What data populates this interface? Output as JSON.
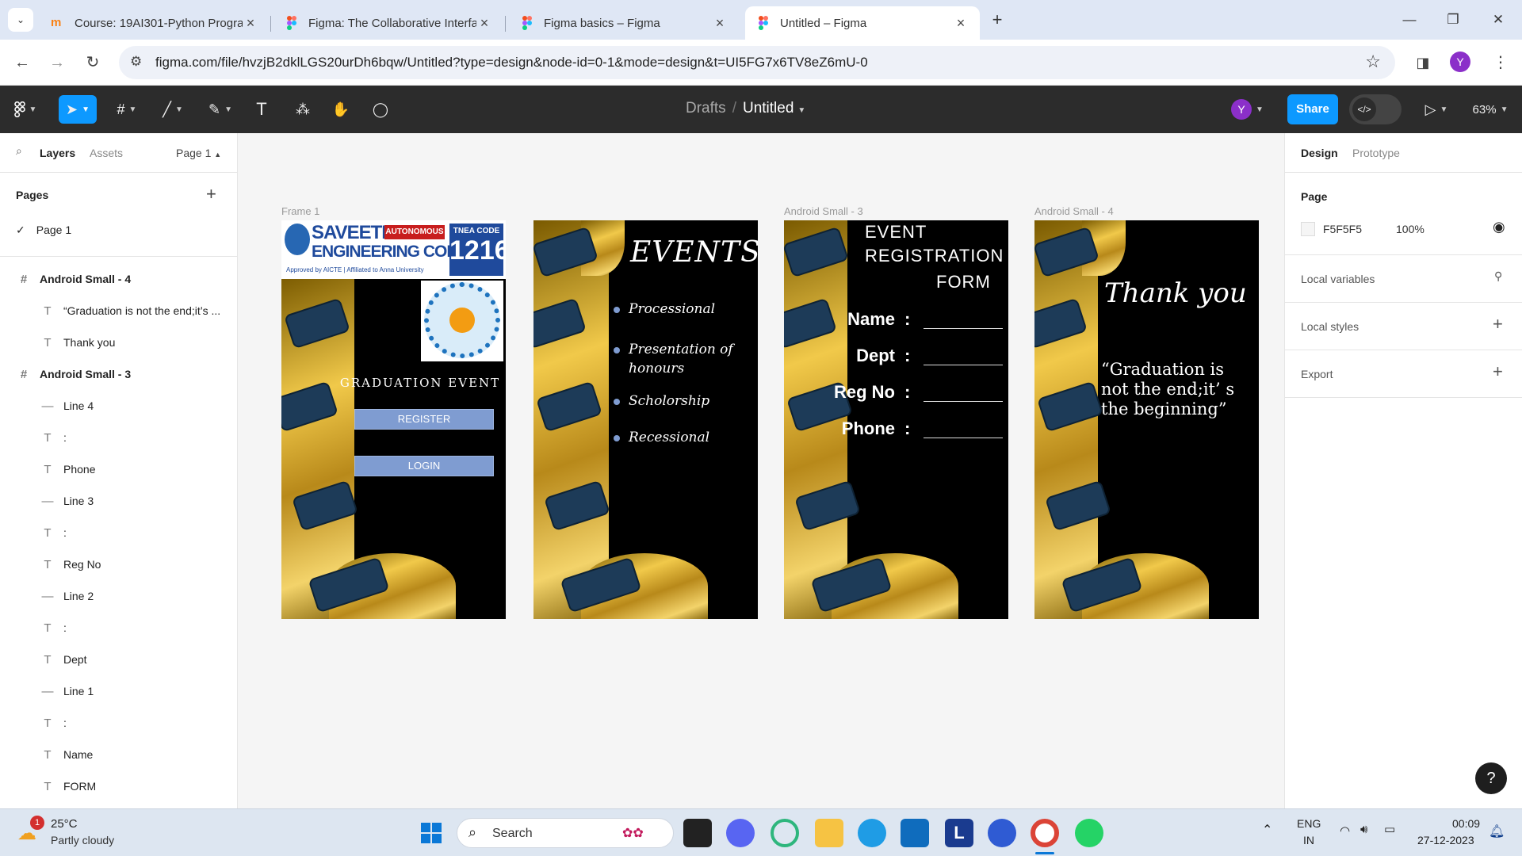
{
  "browser": {
    "tabs": [
      {
        "title": "Course: 19AI301-Python Progra",
        "favicon": "moodle-icon",
        "active": false
      },
      {
        "title": "Figma: The Collaborative Interfa",
        "favicon": "figma-icon",
        "active": false
      },
      {
        "title": "Figma basics – Figma",
        "favicon": "figma-icon",
        "active": false
      },
      {
        "title": "Untitled – Figma",
        "favicon": "figma-icon",
        "active": true
      }
    ],
    "new_tab": "+",
    "url": "figma.com/file/hvzjB2dklLGS20urDh6bqw/Untitled?type=design&node-id=0-1&mode=design&t=UI5FG7x6TV8eZ6mU-0",
    "profile_initial": "Y"
  },
  "figma": {
    "breadcrumb_parent": "Drafts",
    "breadcrumb_sep": "/",
    "file_name": "Untitled",
    "user_initial": "Y",
    "share_label": "Share",
    "zoom": "63%",
    "left_tabs": {
      "layers": "Layers",
      "assets": "Assets",
      "page_selector": "Page 1"
    },
    "pages_title": "Pages",
    "pages": [
      "Page 1"
    ],
    "layers": [
      {
        "name": "Android Small - 4",
        "type": "frame"
      },
      {
        "name": "“Graduation is not the end;it’s ...",
        "type": "text"
      },
      {
        "name": "Thank you",
        "type": "text"
      },
      {
        "name": "Android Small - 3",
        "type": "frame"
      },
      {
        "name": "Line 4",
        "type": "line"
      },
      {
        "name": ":",
        "type": "text"
      },
      {
        "name": "Phone",
        "type": "text"
      },
      {
        "name": "Line 3",
        "type": "line"
      },
      {
        "name": ":",
        "type": "text"
      },
      {
        "name": "Reg No",
        "type": "text"
      },
      {
        "name": "Line 2",
        "type": "line"
      },
      {
        "name": ":",
        "type": "text"
      },
      {
        "name": "Dept",
        "type": "text"
      },
      {
        "name": "Line 1",
        "type": "line"
      },
      {
        "name": ":",
        "type": "text"
      },
      {
        "name": "Name",
        "type": "text"
      },
      {
        "name": "FORM",
        "type": "text"
      }
    ],
    "right_tabs": {
      "design": "Design",
      "prototype": "Prototype"
    },
    "page_section": {
      "title": "Page",
      "color": "F5F5F5",
      "opacity": "100%"
    },
    "sections": [
      "Local variables",
      "Local styles",
      "Export"
    ],
    "help": "?"
  },
  "frames": {
    "frame1": {
      "label": "Frame 1",
      "college_name_1": "SAVEETHA",
      "college_name_2": "ENGINEERING COLLEGE",
      "autonomous": "AUTONOMOUS",
      "approved": "Approved by AICTE | Affiliated to Anna University",
      "tnea_label": "TNEA CODE",
      "tnea_code": "1216",
      "title": "GRADUATION EVENT",
      "register": "REGISTER",
      "login": "LOGIN"
    },
    "frame2": {
      "title": "EVENTS",
      "items": [
        "Processional",
        "Presentation of honours",
        "Scholorship",
        "Recessional"
      ]
    },
    "frame3": {
      "label": "Android Small - 3",
      "title_1": "EVENT",
      "title_2": "REGISTRATION",
      "title_3": "FORM",
      "fields": [
        "Name",
        "Dept",
        "Reg No",
        "Phone"
      ],
      "colon": ":"
    },
    "frame4": {
      "label": "Android Small - 4",
      "title": "Thank you",
      "quote": "“Graduation is not the end;it’ s the beginning”"
    }
  },
  "taskbar": {
    "weather_temp": "25°C",
    "weather_desc": "Partly cloudy",
    "weather_badge": "1",
    "search": "Search",
    "lang_1": "ENG",
    "lang_2": "IN",
    "time": "00:09",
    "date": "27-12-2023"
  },
  "colors": {
    "accent": "#0d99ff",
    "figma_dark": "#2c2c2c",
    "button_blue": "#7f9cd1"
  }
}
